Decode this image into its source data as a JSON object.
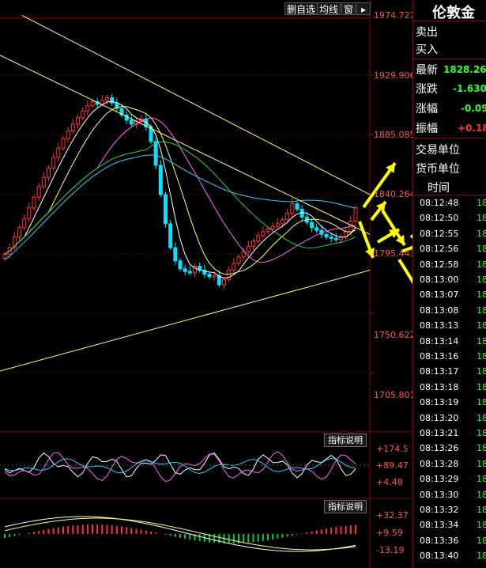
{
  "toolbar": {
    "delete_self_select": "删自选",
    "ma_line": "均线",
    "window": "窗",
    "arrow_icon": "push-pin-icon"
  },
  "price_axis": [
    "1974.727",
    "1929.906",
    "1885.085",
    "1840.264",
    "1795.443",
    "1750.622",
    "1705.801"
  ],
  "indicator_panel_1": {
    "button": "指标说明",
    "axis": [
      "+174.5",
      "+89.47",
      "+4.48"
    ]
  },
  "indicator_panel_2": {
    "button": "指标说明",
    "axis": [
      "+32.37",
      "+9.59",
      "-13.19"
    ]
  },
  "quote": {
    "symbol": "伦敦金",
    "ask_label": "卖出",
    "bid_label": "买入",
    "latest_label": "最新",
    "latest_value": "1828.260",
    "change_label": "涨跌",
    "change_value": "-1.630",
    "change_pct_label": "涨幅",
    "change_pct_value": "-0.09",
    "amplitude_label": "振幅",
    "amplitude_value": "+0.18",
    "trade_unit_label": "交易单位",
    "currency_unit_label": "货币单位",
    "time_header": "时间"
  },
  "ticks": [
    {
      "time": "08:12:48",
      "price": "18"
    },
    {
      "time": "08:12:50",
      "price": "18"
    },
    {
      "time": "08:12:55",
      "price": "18"
    },
    {
      "time": "08:12:56",
      "price": "18"
    },
    {
      "time": "08:12:58",
      "price": "18"
    },
    {
      "time": "08:13:00",
      "price": "18"
    },
    {
      "time": "08:13:07",
      "price": "18"
    },
    {
      "time": "08:13:08",
      "price": "18"
    },
    {
      "time": "08:13:13",
      "price": "18"
    },
    {
      "time": "08:13:14",
      "price": "18"
    },
    {
      "time": "08:13:16",
      "price": "18"
    },
    {
      "time": "08:13:17",
      "price": "18"
    },
    {
      "time": "08:13:18",
      "price": "18"
    },
    {
      "time": "08:13:19",
      "price": "18"
    },
    {
      "time": "08:13:20",
      "price": "18"
    },
    {
      "time": "08:13:21",
      "price": "18"
    },
    {
      "time": "08:13:26",
      "price": "18"
    },
    {
      "time": "08:13:28",
      "price": "18"
    },
    {
      "time": "08:13:29",
      "price": "18"
    },
    {
      "time": "08:13:30",
      "price": "18"
    },
    {
      "time": "08:13:32",
      "price": "18"
    },
    {
      "time": "08:13:34",
      "price": "18"
    },
    {
      "time": "08:13:36",
      "price": "18"
    },
    {
      "time": "08:13:40",
      "price": "18"
    }
  ],
  "colors": {
    "up": "#ff3333",
    "down": "#00e5ff",
    "grid": "#8b0000",
    "trend": "#ffff66",
    "arrow": "#ffff00"
  }
}
